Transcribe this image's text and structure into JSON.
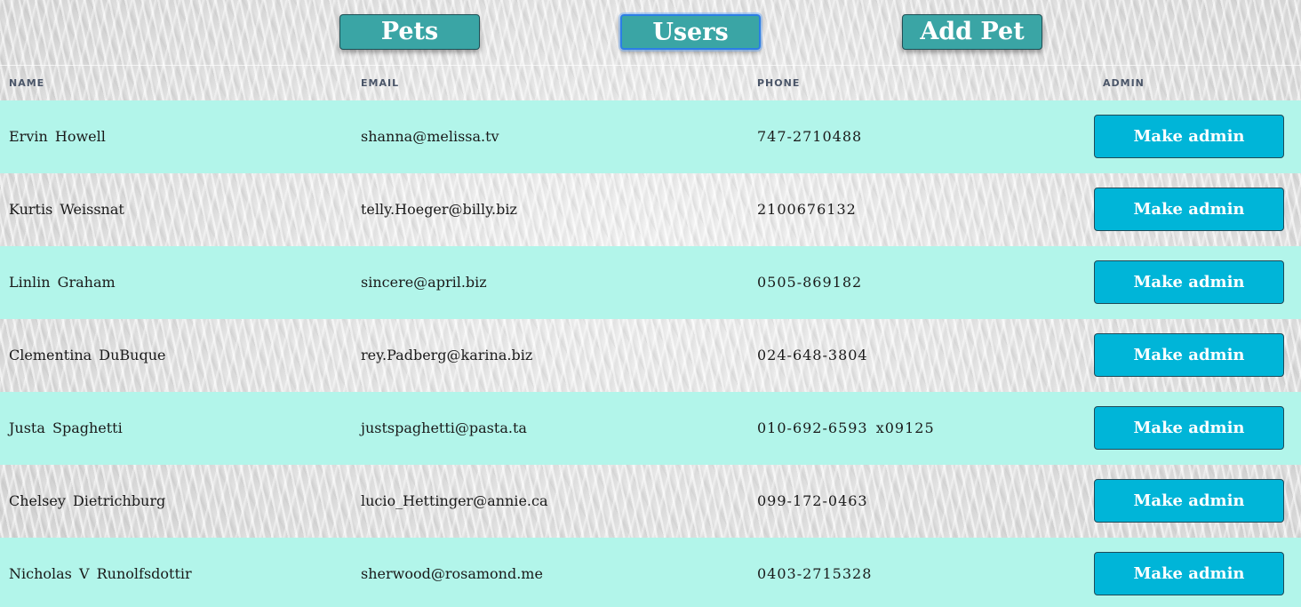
{
  "nav": {
    "pets_label": "Pets",
    "users_label": "Users",
    "add_pet_label": "Add Pet"
  },
  "table": {
    "headers": {
      "name": "NAME",
      "email": "EMAIL",
      "phone": "PHONE",
      "admin": "ADMIN"
    },
    "rows": [
      {
        "name": "Ervin  Howell",
        "email": "shanna@melissa.tv",
        "phone": "747-2710488",
        "action": "Make admin"
      },
      {
        "name": "Kurtis  Weissnat",
        "email": "telly.Hoeger@billy.biz",
        "phone": "2100676132",
        "action": "Make admin"
      },
      {
        "name": "Linlin  Graham",
        "email": "sincere@april.biz",
        "phone": "0505-869182",
        "action": "Make admin"
      },
      {
        "name": "Clementina  DuBuque",
        "email": "rey.Padberg@karina.biz",
        "phone": "024-648-3804",
        "action": "Make admin"
      },
      {
        "name": "Justa  Spaghetti",
        "email": "justspaghetti@pasta.ta",
        "phone": "010-692-6593  x09125",
        "action": "Make admin"
      },
      {
        "name": "Chelsey  Dietrichburg",
        "email": "lucio_Hettinger@annie.ca",
        "phone": "099-172-0463",
        "action": "Make admin"
      },
      {
        "name": "Nicholas  V  Runolfsdottir",
        "email": "sherwood@rosamond.me",
        "phone": "0403-2715328",
        "action": "Make admin"
      }
    ]
  },
  "colors": {
    "nav_button": "#3aa5a5",
    "row_highlight": "#b2f5ea",
    "admin_button": "#00b5d8",
    "active_outline": "#2c7ee6"
  }
}
